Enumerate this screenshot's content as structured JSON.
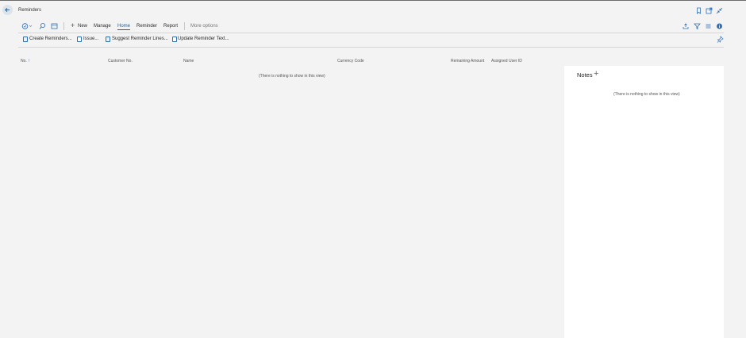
{
  "header": {
    "title": "Reminders",
    "icons": [
      "back-arrow-icon",
      "bookmark-icon",
      "open-new-window-icon",
      "collapse-icon"
    ]
  },
  "actionbar": {
    "new_label": "New",
    "manage_label": "Manage",
    "home_label": "Home",
    "reminder_label": "Reminder",
    "report_label": "Report",
    "more_label": "More options",
    "accent": "#1f5f9e"
  },
  "subactions": {
    "create_label": "Create Reminders...",
    "issue_label": "Issue...",
    "suggest_label": "Suggest Reminder Lines...",
    "update_label": "Update Reminder Text..."
  },
  "table": {
    "columns": {
      "no": "No.",
      "sort_indicator": "↑",
      "customer_no": "Customer No.",
      "name": "Name",
      "currency_code": "Currency Code",
      "remaining_amount": "Remaining Amount",
      "assigned_user": "Assigned User ID"
    },
    "empty_message": "(There is nothing to show in this view)"
  },
  "notes": {
    "title": "Notes",
    "add_symbol": "+",
    "empty_message": "(There is nothing to show in this view)"
  }
}
